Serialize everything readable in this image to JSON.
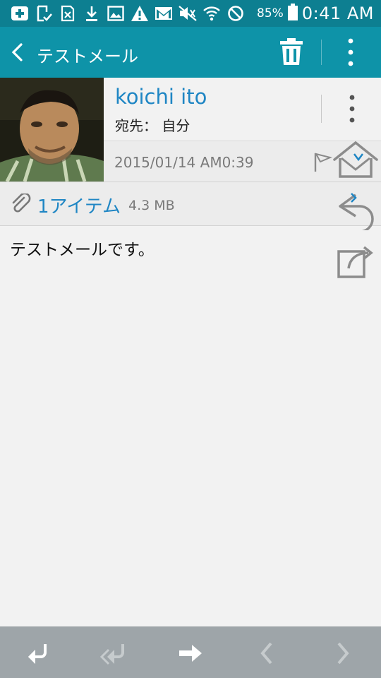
{
  "status_bar": {
    "battery_percent": "85%",
    "time": "0:41 AM",
    "icons": [
      "notification-plus-icon",
      "download-check-icon",
      "excel-doc-icon",
      "download-icon",
      "image-icon",
      "warning-icon",
      "gmail-icon",
      "mute-icon",
      "wifi-icon",
      "block-icon",
      "battery-icon"
    ]
  },
  "action_bar": {
    "title": "テストメール",
    "icons": [
      "back-icon",
      "trash-icon",
      "more-vert-icon"
    ]
  },
  "message": {
    "sender_name": "koichi ito",
    "recipient": "宛先： 自分",
    "date": "2015/01/14  AM0:39",
    "attachment_count": "1アイテム",
    "attachment_size": "4.3 MB",
    "body": "テストメールです。"
  },
  "bottom_bar": {
    "buttons": [
      "reply-icon",
      "reply-all-icon",
      "forward-icon",
      "previous-icon",
      "next-icon"
    ]
  },
  "colors": {
    "status_bar": "#0d7f91",
    "action_bar": "#0e93a8",
    "accent_blue": "#1f86c4",
    "bottom_bar": "#9ea5a9"
  }
}
